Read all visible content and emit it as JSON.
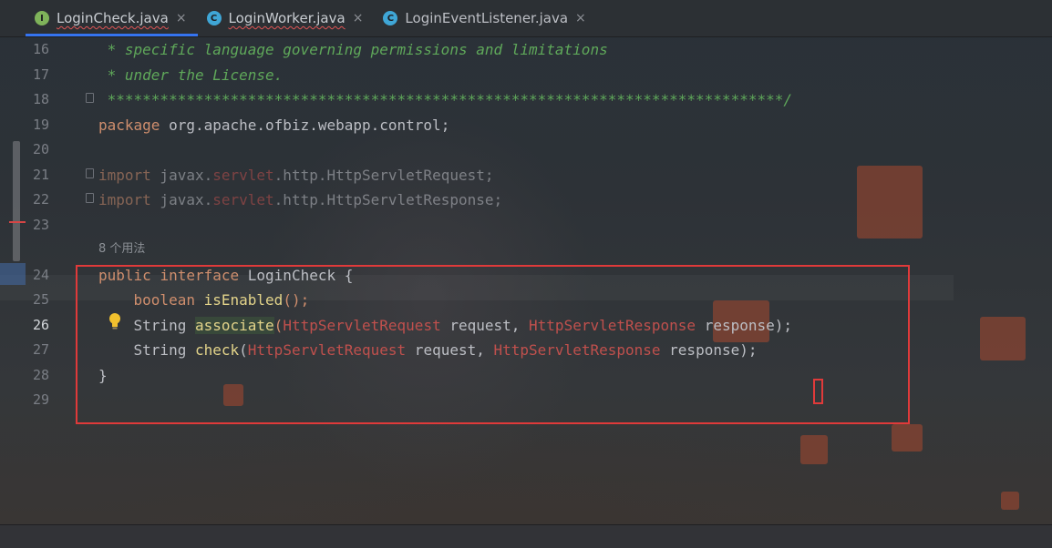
{
  "tabs": [
    {
      "icon_letter": "I",
      "icon_color": "#7fb35a",
      "label": "LoginCheck.java",
      "close": "×",
      "active": true,
      "error_underline": true
    },
    {
      "icon_letter": "C",
      "icon_color": "#3fa6d6",
      "label": "LoginWorker.java",
      "close": "×",
      "active": false,
      "error_underline": true
    },
    {
      "icon_letter": "C",
      "icon_color": "#3fa6d6",
      "label": "LoginEventListener.java",
      "close": "×",
      "active": false,
      "error_underline": false
    }
  ],
  "gutter": {
    "line_numbers": [
      "16",
      "17",
      "18",
      "19",
      "20",
      "21",
      "22",
      "23",
      "24",
      "25",
      "26",
      "27",
      "28",
      "29"
    ],
    "current_line": "26"
  },
  "code": {
    "l16": " * specific language governing permissions and limitations",
    "l17": " * under the License.",
    "l18": " *****************************************************************************/",
    "l19_kw": "package",
    "l19_rest": " org.apache.ofbiz.webapp.control;",
    "l21_kw": "import",
    "l21_a": " javax.",
    "l21_b": "servlet",
    "l21_c": ".http.HttpServletRequest;",
    "l22_kw": "import",
    "l22_a": " javax.",
    "l22_b": "servlet",
    "l22_c": ".http.HttpServletResponse;",
    "usage_hint": "8 个用法",
    "l24_kw1": "public",
    "l24_kw2": "interface",
    "l24_rest": " LoginCheck {",
    "l25_kw": "boolean",
    "l25_meth": "isEnabled",
    "l25_rest": "();",
    "l26_type": "String",
    "l26_meth": "associate",
    "l26_p1": "HttpServletRequest",
    "l26_n1": " request, ",
    "l26_p2": "HttpServletResponse",
    "l26_n2": " response);",
    "l27_type": "String",
    "l27_meth": "check",
    "l27_p1": "HttpServletRequest",
    "l27_n1": " request, ",
    "l27_p2": "HttpServletResponse",
    "l27_n2": " response);",
    "l28": "}"
  },
  "colors": {
    "comment": "#5fa85a",
    "keyword": "#cf8e6d",
    "method": "#e3d48a",
    "error_type": "#c0504d",
    "annotation": "#e03a3a",
    "tab_accent": "#3574f0"
  }
}
